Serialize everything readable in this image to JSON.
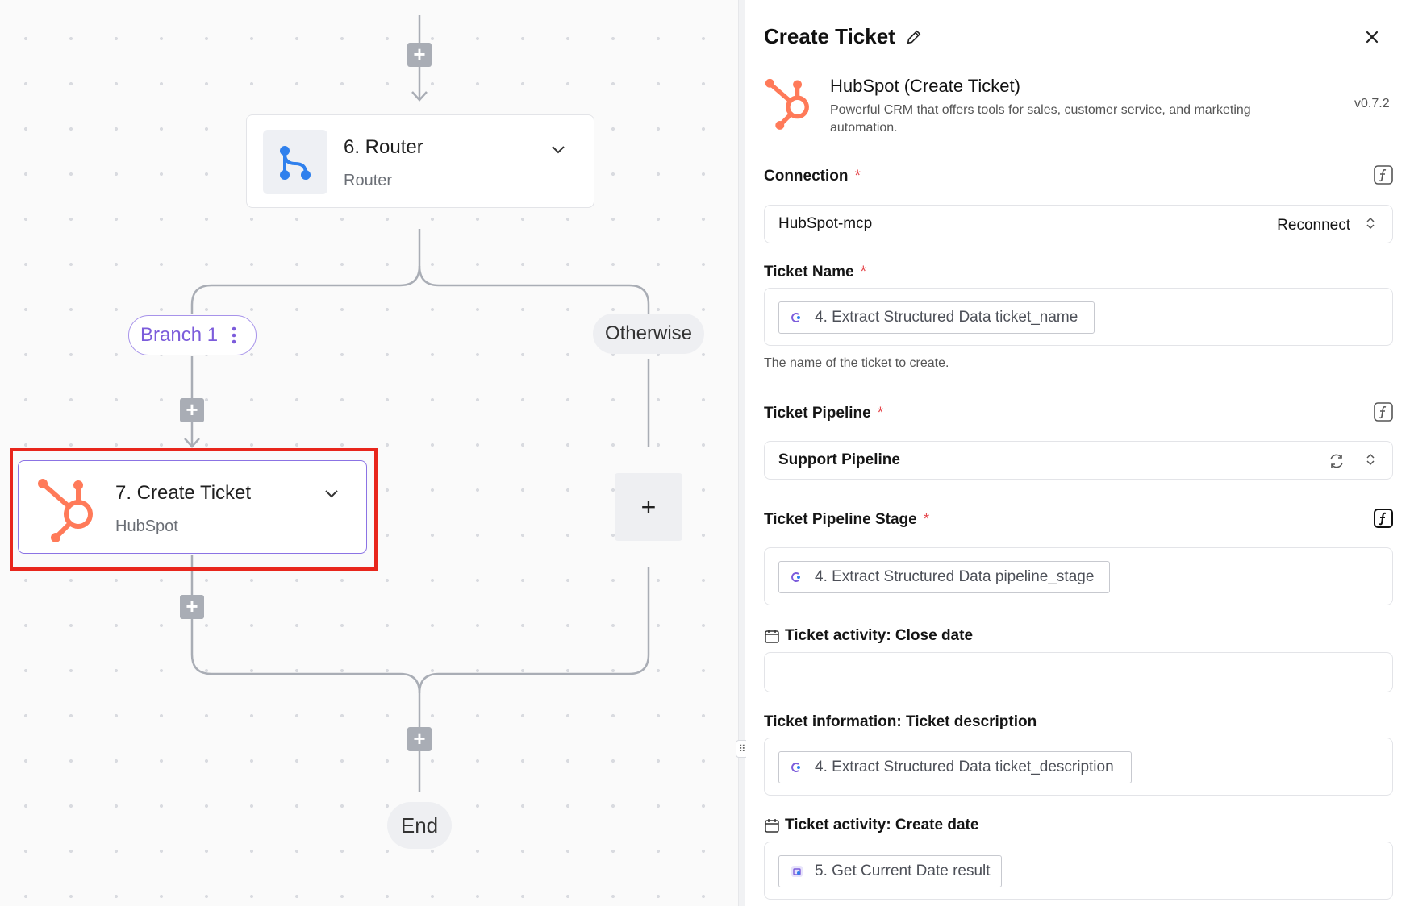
{
  "flow": {
    "router_step": {
      "title": "6. Router",
      "subtitle": "Router"
    },
    "branch_1": {
      "label": "Branch 1"
    },
    "otherwise": {
      "label": "Otherwise"
    },
    "ticket_step": {
      "title": "7. Create Ticket",
      "subtitle": "HubSpot"
    },
    "end": {
      "label": "End"
    },
    "add_symbol": "+"
  },
  "panel": {
    "title": "Create Ticket",
    "piece": {
      "name": "HubSpot (Create Ticket)",
      "description": "Powerful CRM that offers tools for sales, customer service, and marketing automation.",
      "version": "v0.7.2"
    },
    "connection": {
      "label": "Connection",
      "value": "HubSpot-mcp",
      "action": "Reconnect"
    },
    "ticket_name": {
      "label": "Ticket Name",
      "chip": "4. Extract Structured Data ticket_name",
      "help": "The name of the ticket to create."
    },
    "ticket_pipeline": {
      "label": "Ticket Pipeline",
      "value": "Support Pipeline"
    },
    "ticket_pipeline_stage": {
      "label": "Ticket Pipeline Stage",
      "chip": "4. Extract Structured Data pipeline_stage"
    },
    "close_date": {
      "label": "Ticket activity: Close date"
    },
    "ticket_description": {
      "label": "Ticket information: Ticket description",
      "chip": "4. Extract Structured Data ticket_description"
    },
    "create_date": {
      "label": "Ticket activity: Create date",
      "chip": "5. Get Current Date result"
    }
  },
  "colors": {
    "hubspot": "#ff7a59",
    "router": "#2f80ed",
    "branch_purple": "#7c5cdb",
    "selection_red": "#e8261c",
    "required": "#e5484d"
  },
  "icons": [
    "hubspot-icon",
    "router-icon",
    "chevron-down-icon",
    "pencil-icon",
    "close-icon",
    "fx-icon",
    "refresh-icon",
    "sort-arrows-icon",
    "calendar-icon"
  ]
}
